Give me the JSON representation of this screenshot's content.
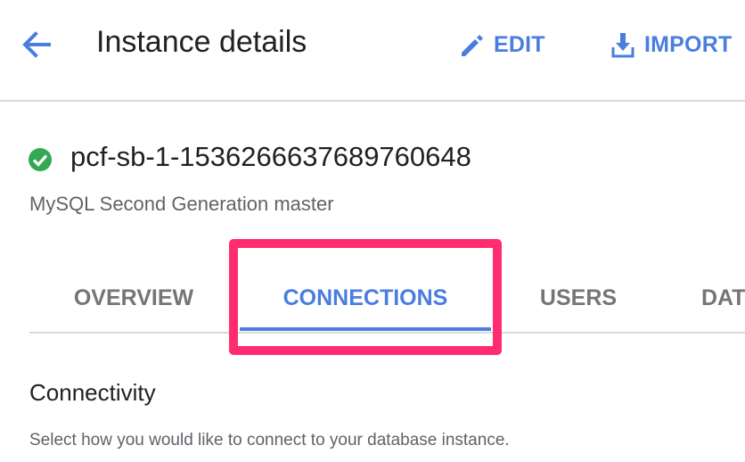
{
  "header": {
    "title": "Instance details",
    "edit_label": "EDIT",
    "import_label": "IMPORT"
  },
  "instance": {
    "name": "pcf-sb-1-1536266637689760648",
    "type": "MySQL Second Generation master",
    "status_icon": "check-circle-icon"
  },
  "tabs": [
    {
      "label": "OVERVIEW"
    },
    {
      "label": "CONNECTIONS",
      "selected": true
    },
    {
      "label": "USERS"
    },
    {
      "label": "DAT"
    }
  ],
  "section": {
    "title": "Connectivity",
    "description": "Select how you would like to connect to your database instance."
  },
  "colors": {
    "accent": "#4a7de0",
    "highlight": "#ff2d6f",
    "success": "#34a853"
  }
}
